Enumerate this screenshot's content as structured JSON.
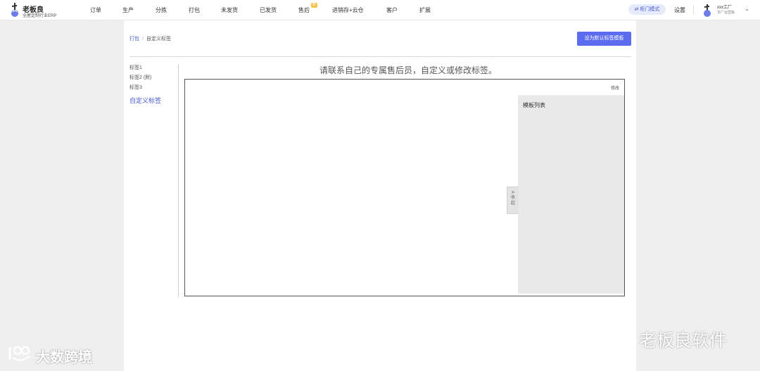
{
  "brand": {
    "name": "老板良",
    "subtitle": "全屋定制行业ERP"
  },
  "nav": {
    "items": [
      "订单",
      "生产",
      "分拣",
      "打包",
      "未发货",
      "已发货",
      "售后",
      "进销存+云仓",
      "客户",
      "扩展"
    ],
    "badge": "新"
  },
  "header": {
    "mode_label": "⇄ 柜门模式",
    "settings_label": "设置",
    "user_name": "xxx工厂",
    "user_role": "多厂运营版"
  },
  "breadcrumb": {
    "parent": "打包",
    "separator": "/",
    "current": "自定义标签"
  },
  "actions": {
    "set_default_label": "设为默认标签模板"
  },
  "labels": {
    "items": [
      "标签1",
      "标签2 (默)",
      "标签3"
    ],
    "custom": "自定义标签"
  },
  "notice": "请联系自己的专属售后员，自定义或修改标签。",
  "side_panel": {
    "edit_label": "修改",
    "title": "模板列表",
    "collapse_arrow": "»",
    "collapse_label": "收起"
  },
  "watermarks": {
    "left": "大数跨境",
    "right": "老板良软件"
  },
  "colors": {
    "accent": "#5b6cf0",
    "link": "#4b5bd6",
    "badge": "#f6c24a"
  }
}
